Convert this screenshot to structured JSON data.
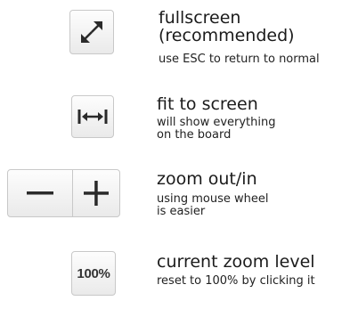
{
  "items": [
    {
      "icon": "expand-arrows-icon",
      "title_lines": [
        "fullscreen",
        "(recommended)"
      ],
      "desc_lines": [
        "use ESC to return to normal"
      ]
    },
    {
      "icon": "fit-horizontal-icon",
      "title_lines": [
        "fit to screen"
      ],
      "desc_lines": [
        "will show everything",
        "on the board"
      ]
    },
    {
      "icon": "minus-plus-icons",
      "title_lines": [
        "zoom out/in"
      ],
      "desc_lines": [
        "using mouse wheel",
        "is easier"
      ]
    },
    {
      "icon": "zoom-level-badge",
      "button_text": "100%",
      "title_lines": [
        "current zoom level"
      ],
      "desc_lines": [
        "reset to 100% by clicking it"
      ]
    }
  ]
}
